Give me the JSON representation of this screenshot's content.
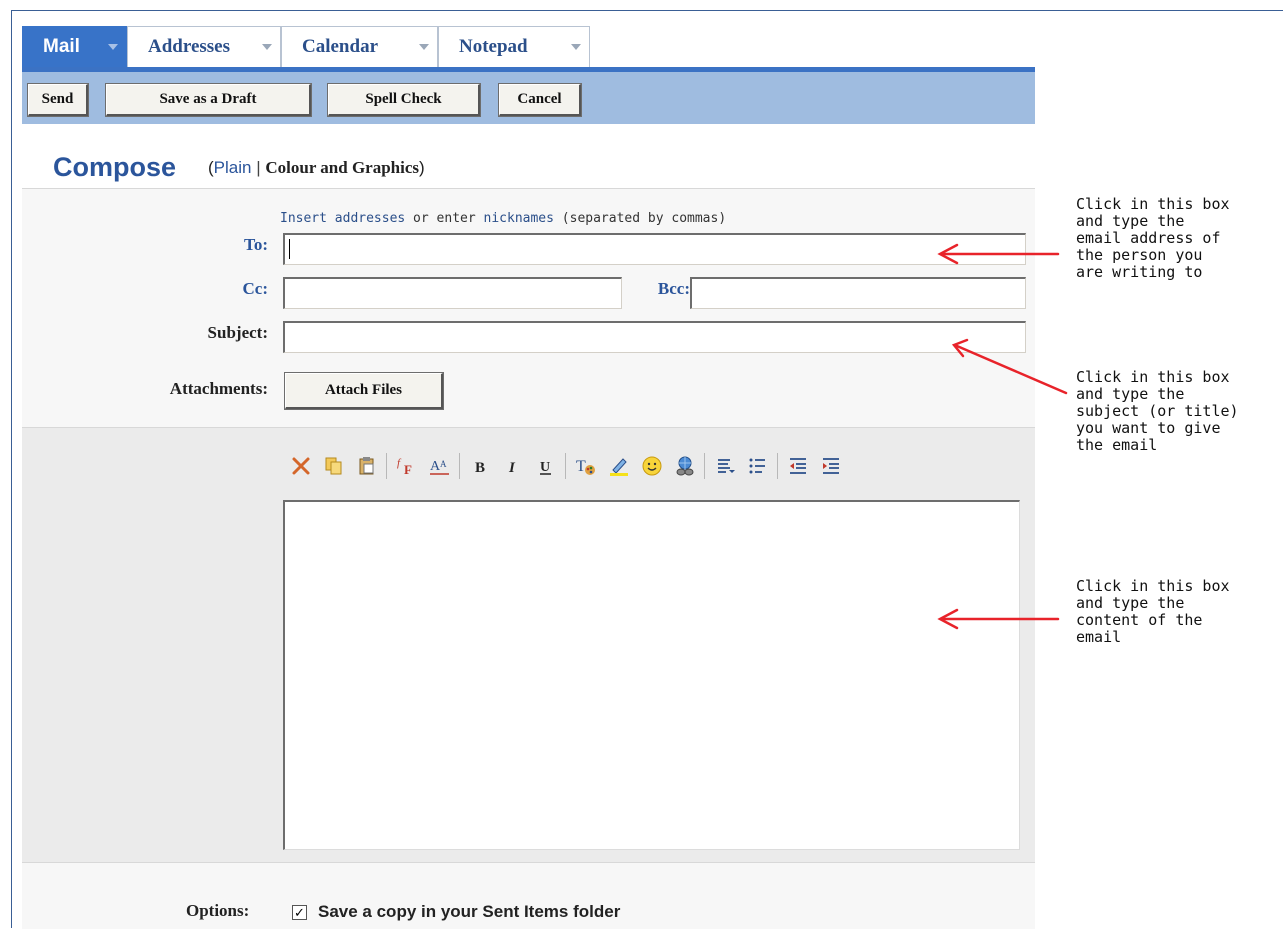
{
  "tabs": [
    {
      "label": "Mail",
      "active": true
    },
    {
      "label": "Addresses",
      "active": false
    },
    {
      "label": "Calendar",
      "active": false
    },
    {
      "label": "Notepad",
      "active": false
    }
  ],
  "toolbar": {
    "send_label": "Send",
    "save_draft_label": "Save as a Draft",
    "spell_check_label": "Spell Check",
    "cancel_label": "Cancel"
  },
  "compose": {
    "title": "Compose",
    "open_paren": "(",
    "plain_label": "Plain",
    "separator": " | ",
    "colour_graphics_label": "Colour and Graphics",
    "close_paren": ")"
  },
  "address": {
    "insert_addresses_link": "Insert addresses",
    "or_enter_text": " or enter ",
    "nicknames_link": "nicknames",
    "separated_text": " (separated by commas)",
    "to_label": "To:",
    "cc_label": "Cc:",
    "bcc_label": "Bcc:",
    "subject_label": "Subject:",
    "attachments_label": "Attachments:",
    "attach_files_label": "Attach Files",
    "to_value": "",
    "cc_value": "",
    "bcc_value": "",
    "subject_value": ""
  },
  "editor_toolbar": [
    "cut-icon",
    "copy-icon",
    "paste-icon",
    "font-icon",
    "font-size-icon",
    "bold-icon",
    "italic-icon",
    "underline-icon",
    "text-color-icon",
    "highlight-icon",
    "emoticon-icon",
    "link-icon",
    "align-icon",
    "bullet-list-icon",
    "outdent-icon",
    "indent-icon"
  ],
  "options": {
    "label": "Options:",
    "save_copy_label": "Save a copy in your Sent Items folder",
    "save_copy_checked": true,
    "check_mark": "✓"
  },
  "annotations": {
    "to_note": "Click in this box\nand type the\nemail address of\nthe person you\nare writing to",
    "subject_note": "Click in this box\nand type the\nsubject (or title)\nyou want to give\nthe email",
    "body_note": "Click in this box\nand type the\ncontent of the\nemail"
  },
  "colors": {
    "tab_active": "#3873c8",
    "toolbar_bg": "#9fbce0",
    "heading_blue": "#2b559b",
    "arrow_red": "#e8232a"
  }
}
